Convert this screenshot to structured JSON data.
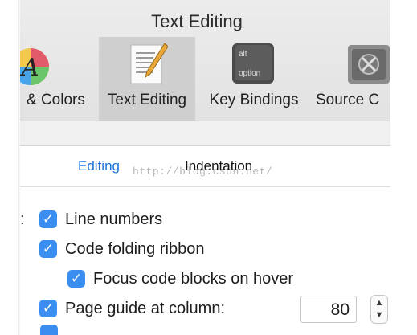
{
  "window": {
    "title": "Text Editing"
  },
  "toolbar": {
    "tabs": [
      {
        "label": "& Colors",
        "icon": "color-palette-icon",
        "selected": false
      },
      {
        "label": "Text Editing",
        "icon": "text-editing-icon",
        "selected": true
      },
      {
        "label": "Key Bindings",
        "icon": "keyboard-key-icon",
        "selected": false,
        "key_top": "alt",
        "key_bottom": "option"
      },
      {
        "label": "Source C",
        "icon": "source-control-icon",
        "selected": false
      }
    ],
    "palette_letter": "A"
  },
  "segments": {
    "editing": "Editing",
    "indentation": "Indentation"
  },
  "watermark": "http://blog.csdn.net/",
  "options": {
    "colon": ":",
    "line_numbers": {
      "label": "Line numbers",
      "checked": true
    },
    "code_folding": {
      "label": "Code folding ribbon",
      "checked": true
    },
    "focus_blocks": {
      "label": "Focus code blocks on hover",
      "checked": true
    },
    "page_guide": {
      "label": "Page guide at column:",
      "checked": true,
      "value": "80"
    }
  },
  "colors": {
    "accent": "#3b8ef0",
    "selected_link": "#1e73d9"
  }
}
